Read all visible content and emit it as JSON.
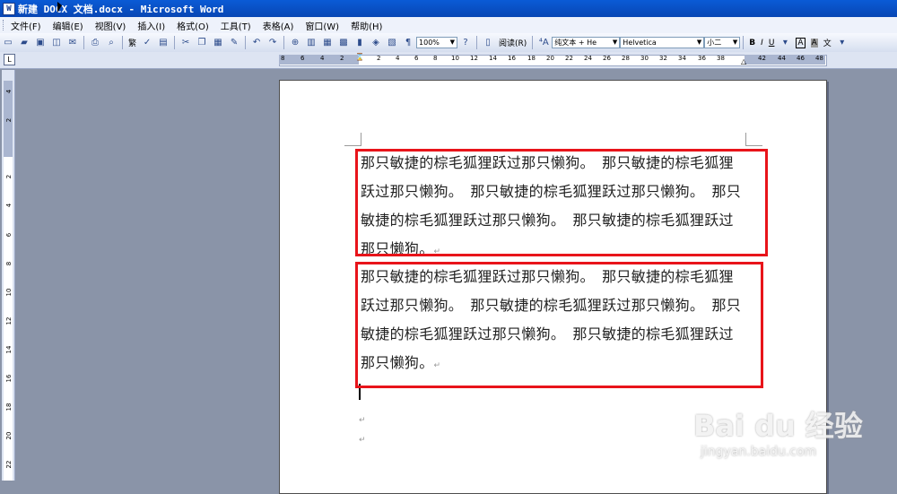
{
  "window": {
    "title": "新建 DOCX 文档.docx - Microsoft Word",
    "app_icon": "word-doc-icon"
  },
  "menu": [
    "文件(F)",
    "编辑(E)",
    "视图(V)",
    "插入(I)",
    "格式(O)",
    "工具(T)",
    "表格(A)",
    "窗口(W)",
    "帮助(H)"
  ],
  "toolbar": {
    "zoom": "100%",
    "read_label": "阅读(R)",
    "style": "纯文本 + He",
    "font": "Helvetica",
    "size": "小二",
    "bold": "B",
    "italic": "I",
    "underline": "U",
    "font_color": "A",
    "char_shading": "A",
    "phonetic": "文",
    "traditional": "繁"
  },
  "ruler": {
    "ticks": [
      "8",
      "6",
      "4",
      "2",
      "2",
      "4",
      "6",
      "8",
      "10",
      "12",
      "14",
      "16",
      "18",
      "20",
      "22",
      "24",
      "26",
      "28",
      "30",
      "32",
      "34",
      "36",
      "38",
      "42",
      "44",
      "46",
      "48"
    ],
    "tab_selector": "L",
    "vticks": [
      "4",
      "2",
      "2",
      "4",
      "6",
      "8",
      "10",
      "12",
      "14",
      "16",
      "18",
      "20",
      "22"
    ]
  },
  "document": {
    "paragraphs": [
      "那只敏捷的棕毛狐狸跃过那只懒狗。　那只敏捷的棕毛狐狸跃过那只懒狗。　那只敏捷的棕毛狐狸跃过那只懒狗。　那只敏捷的棕毛狐狸跃过那只懒狗。　那只敏捷的棕毛狐狸跃过那只懒狗。",
      "那只敏捷的棕毛狐狸跃过那只懒狗。　那只敏捷的棕毛狐狸跃过那只懒狗。　那只敏捷的棕毛狐狸跃过那只懒狗。　那只敏捷的棕毛狐狸跃过那只懒狗。　那只敏捷的棕毛狐狸跃过那只懒狗。"
    ],
    "paragraph_mark": "↵"
  },
  "highlight_color": "#e8141a",
  "watermark": {
    "brand": "Bai du 经验",
    "url": "jingyan.baidu.com"
  }
}
